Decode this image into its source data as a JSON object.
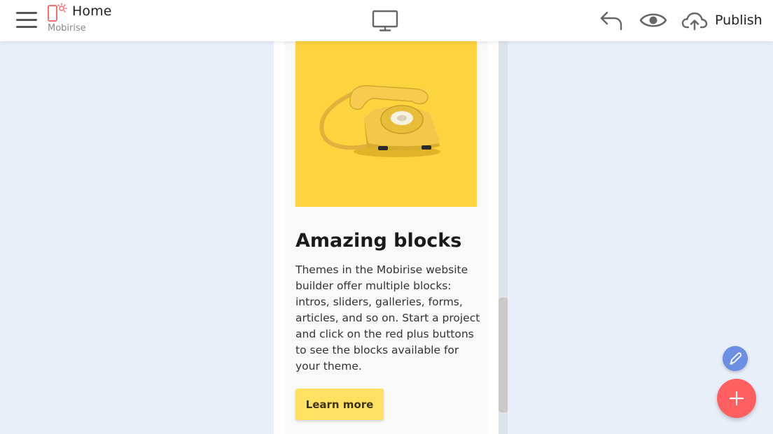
{
  "header": {
    "page_title": "Home",
    "site_name": "Mobirise",
    "publish_label": "Publish",
    "icons": {
      "menu": "hamburger-menu-icon",
      "logo": "mobirise-phone-logo-icon",
      "device": "desktop-monitor-icon",
      "undo": "undo-arrow-icon",
      "preview": "eye-icon",
      "publish": "cloud-upload-icon"
    }
  },
  "card": {
    "image_icon": "yellow-rotary-telephone-image",
    "title": "Amazing blocks",
    "text": "Themes in the Mobirise website builder offer multiple blocks: intros, sliders, galleries, forms, articles, and so on. Start a project and click on the red plus buttons to see the blocks available for your theme.",
    "button_label": "Learn more"
  },
  "fabs": {
    "edit_icon": "pencil-icon",
    "add_icon": "plus-icon"
  },
  "colors": {
    "background": "#e8eefa",
    "accent_red": "#ff5f5f",
    "accent_blue": "#6c8fe3",
    "card_image_bg": "#fdd340",
    "button_bg": "#ffe161"
  }
}
